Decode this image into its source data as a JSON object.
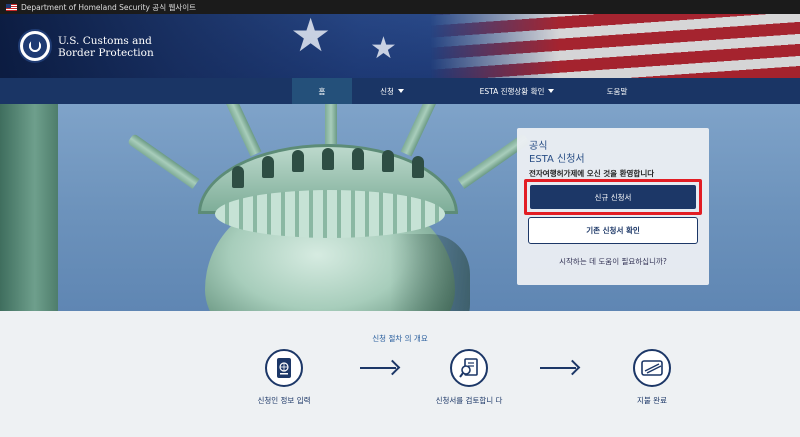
{
  "gov_banner": {
    "text": "Department of Homeland Security 공식 웹사이트"
  },
  "agency": {
    "line1": "U.S. Customs and",
    "line2": "Border Protection"
  },
  "nav": {
    "items": [
      {
        "label": "홈",
        "active": true,
        "dropdown": false
      },
      {
        "label": "신청",
        "active": false,
        "dropdown": true
      },
      {
        "label": "ESTA 진행상황 확인",
        "active": false,
        "dropdown": true
      },
      {
        "label": "도움말",
        "active": false,
        "dropdown": false
      }
    ]
  },
  "panel": {
    "title_line1": "공식",
    "title_line2": "ESTA 신청서",
    "welcome": "전자여행허가제에 오신 것을 환영합니다",
    "primary_button": "신규 신청서",
    "secondary_button": "기존 신청서 확인",
    "help_link": "시작하는 데 도움이 필요하십니까?"
  },
  "process": {
    "title": "신청 절차 의 개요",
    "steps": [
      {
        "label": "신청인 정보 입력",
        "icon": "passport-icon"
      },
      {
        "label": "신청서를 검토합니 다",
        "icon": "review-document-icon"
      },
      {
        "label": "지불 완료",
        "icon": "credit-card-icon"
      }
    ]
  },
  "colors": {
    "navy": "#1c3767",
    "nav_bg": "#1a3565",
    "highlight_red": "#e21d24",
    "accent_blue": "#2a5f9e"
  }
}
